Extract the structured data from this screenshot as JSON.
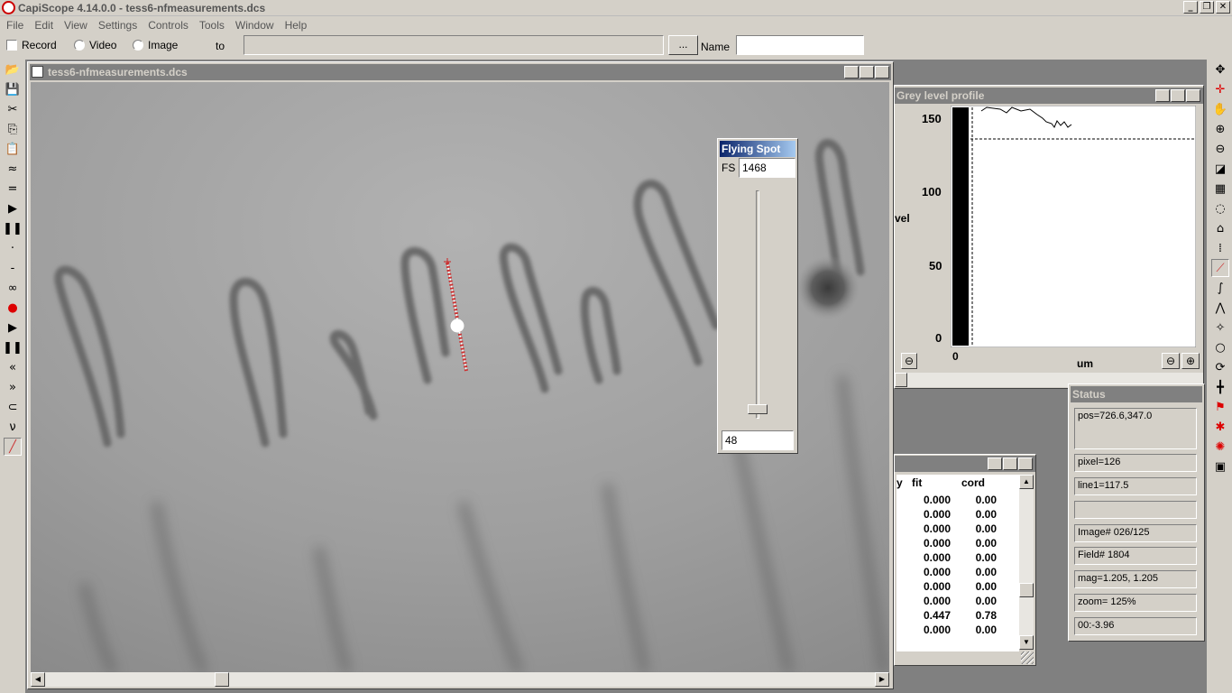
{
  "app": {
    "title": "CapiScope 4.14.0.0 - tess6-nfmeasurements.dcs"
  },
  "menu": [
    "File",
    "Edit",
    "View",
    "Settings",
    "Controls",
    "Tools",
    "Window",
    "Help"
  ],
  "toolbar": {
    "record_label": "Record",
    "video_label": "Video",
    "image_label": "Image",
    "to_label": "to",
    "path_value": "",
    "browse_label": "...",
    "name_label": "Name",
    "name_value": ""
  },
  "image_window": {
    "title": "tess6-nfmeasurements.dcs"
  },
  "flying_spot": {
    "title": "Flying Spot",
    "fs_label": "FS",
    "fs_value": "1468",
    "slider_value": "48"
  },
  "grey_profile": {
    "title": "Grey level profile",
    "y_ticks": [
      "150",
      "100",
      "50",
      "0"
    ],
    "ylabel": "vel",
    "xlabel": "um",
    "x_zero": "0"
  },
  "fit_table": {
    "headers": [
      "y",
      "fit",
      "cord"
    ],
    "rows": [
      [
        "0.000",
        "0.00"
      ],
      [
        "0.000",
        "0.00"
      ],
      [
        "0.000",
        "0.00"
      ],
      [
        "0.000",
        "0.00"
      ],
      [
        "0.000",
        "0.00"
      ],
      [
        "0.000",
        "0.00"
      ],
      [
        "0.000",
        "0.00"
      ],
      [
        "0.000",
        "0.00"
      ],
      [
        "0.447",
        "0.78"
      ],
      [
        "0.000",
        "0.00"
      ]
    ]
  },
  "status": {
    "title": "Status",
    "pos": "pos=726.6,347.0",
    "pixel": "pixel=126",
    "line1": "line1=117.5",
    "blank": "",
    "image": "Image# 026/125",
    "field": "Field# 1804",
    "mag": "mag=1.205, 1.205",
    "zoom": "zoom= 125%",
    "time": "00:-3.96"
  },
  "icons": {
    "left_toolbar": [
      "open-icon",
      "save-icon",
      "cut-icon",
      "copy-icon",
      "paste-icon",
      "wave-icon",
      "equals-icon",
      "play-icon",
      "pause-icon",
      "dot-small-icon",
      "dash-small-icon",
      "glasses-icon",
      "record-icon",
      "play-icon",
      "pause-icon",
      "rewind-icon",
      "fast-forward-icon",
      "loop-icon",
      "nu-icon",
      "line-tool-icon"
    ],
    "right_toolbar": [
      "move-icon",
      "crosshair-icon",
      "hand-icon",
      "zoom-in-icon",
      "zoom-out-icon",
      "highlight-icon",
      "grid-icon",
      "circle-gray-icon",
      "flood-icon",
      "grid-dots-icon",
      "line-measure-icon",
      "curve-icon",
      "polyline-icon",
      "freeform-icon",
      "ellipse-icon",
      "circle-arrows-icon",
      "cross-measure-icon",
      "red-marker-icon",
      "red-star-icon",
      "red-splat-icon",
      "image-tool-icon"
    ]
  }
}
